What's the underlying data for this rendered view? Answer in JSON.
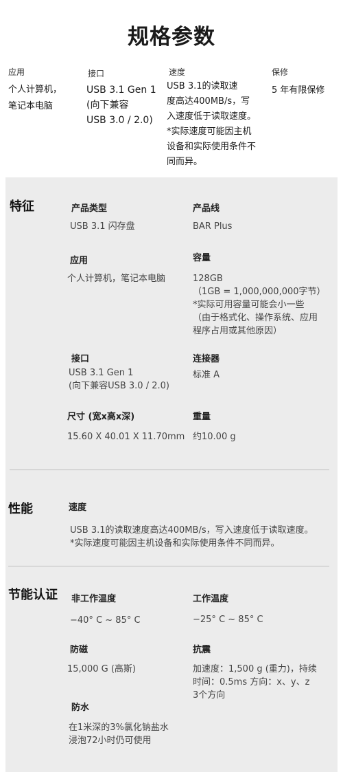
{
  "title": "规格参数",
  "summary": [
    {
      "label": "应用",
      "value": "个人计算机，\n笔记本电脑"
    },
    {
      "label": "接口",
      "value": "USB 3.1 Gen 1\n(向下兼容\nUSB 3.0 / 2.0)"
    },
    {
      "label": "速度",
      "value": "USB 3.1的读取速\n度高达400MB/s，写\n入速度低于读取速度。\n*实际速度可能因主机\n设备和实际使用条件不\n同而异。"
    },
    {
      "label": "保修",
      "value": "5 年有限保修"
    }
  ],
  "features": {
    "heading": "特征",
    "items": [
      {
        "label": "产品类型",
        "value": "USB 3.1 闪存盘"
      },
      {
        "label": "产品线",
        "value": "BAR Plus"
      },
      {
        "label": "应用",
        "value": "个人计算机，笔记本电脑"
      },
      {
        "label": "容量",
        "value": "128GB\n（1GB = 1,000,000,000字节）\n*实际可用容量可能会小一些\n（由于格式化、操作系统、应用\n程序占用或其他原因）"
      },
      {
        "label": "接口",
        "value": "USB 3.1 Gen 1\n(向下兼容USB 3.0 / 2.0)"
      },
      {
        "label": "连接器",
        "value": "标准 A"
      },
      {
        "label": "尺寸 (宽x高x深)",
        "value": "15.60 X 40.01 X 11.70mm"
      },
      {
        "label": "重量",
        "value": "约10.00 g"
      }
    ]
  },
  "performance": {
    "heading": "性能",
    "label": "速度",
    "value": "USB 3.1的读取速度高达400MB/s，写入速度低于读取速度。\n*实际速度可能因主机设备和实际使用条件不同而异。"
  },
  "certification": {
    "heading": "节能认证",
    "items": [
      {
        "label": "非工作温度",
        "value": "−40° C ~ 85° C"
      },
      {
        "label": "工作温度",
        "value": "−25° C ~ 85° C"
      },
      {
        "label": "防磁",
        "value": "15,000 G (高斯)"
      },
      {
        "label": "抗震",
        "value": "加速度：1,500 g (重力)，持续\n时间：0.5ms 方向：x、y、z\n3个方向"
      },
      {
        "label": "防水",
        "value": "在1米深的3%氯化钠盐水\n浸泡72小时仍可使用"
      }
    ]
  }
}
